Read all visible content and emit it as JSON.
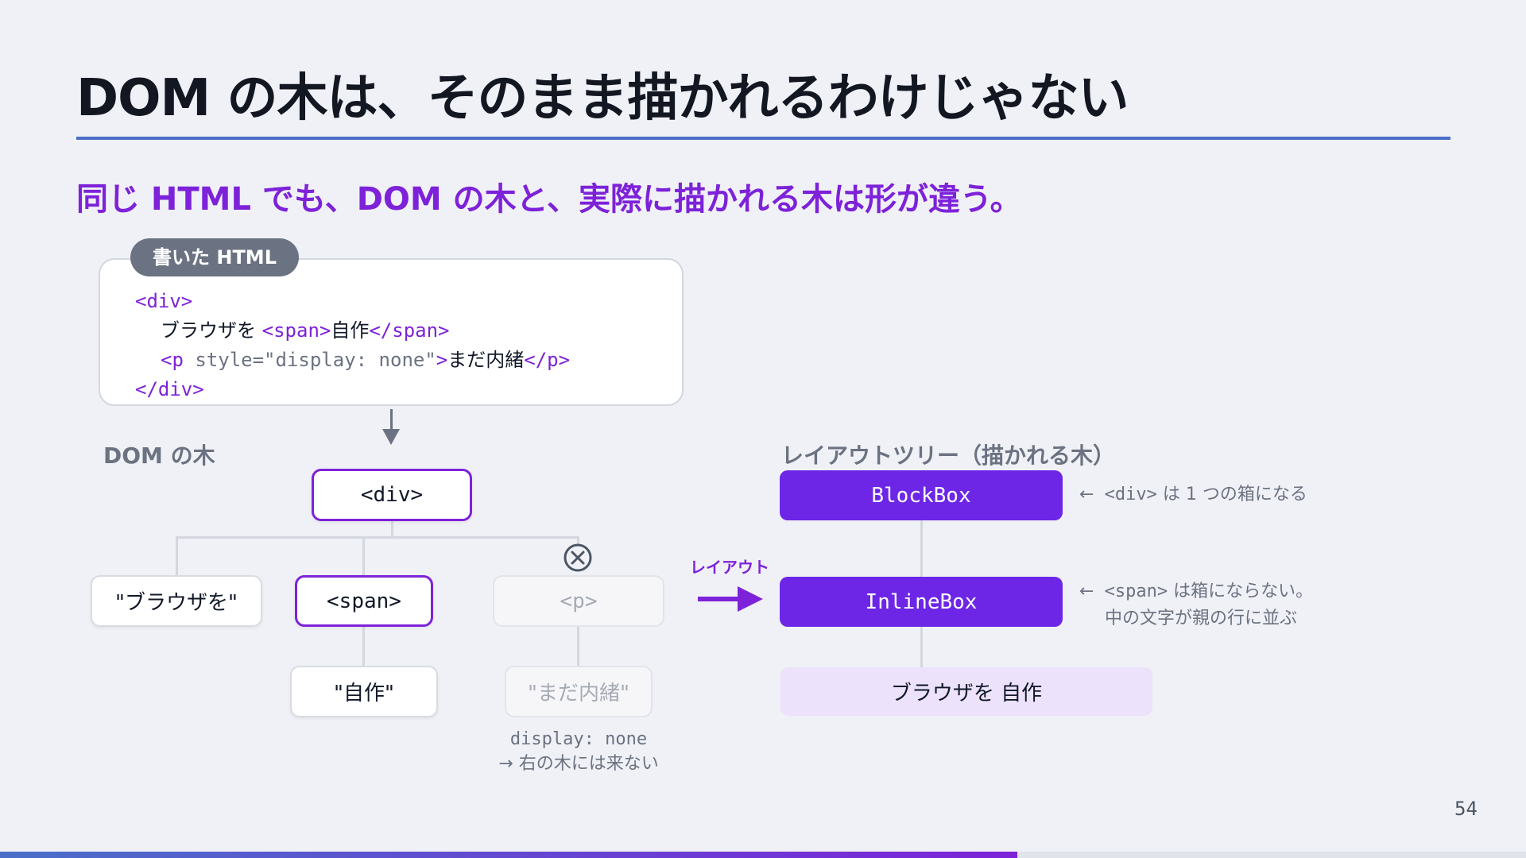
{
  "title": "DOM の木は、そのまま描かれるわけじゃない",
  "subtitle": "同じ HTML でも、DOM の木と、実際に描かれる木は形が違う。",
  "code_card": {
    "label": "書いた HTML",
    "line1_open": "<div>",
    "line2_text": "ブラウザを ",
    "line2_tag_open": "<span>",
    "line2_inner": "自作",
    "line2_tag_close": "</span>",
    "line3_tag_open": "<p",
    "line3_attr": " style=\"display: none\"",
    "line3_tag_gt": ">",
    "line3_inner": "まだ内緒",
    "line3_tag_close": "</p>",
    "line4_close": "</div>"
  },
  "dom_tree": {
    "label": "DOM の木",
    "root": "<div>",
    "children": [
      "\"ブラウザを\"",
      "<span>",
      "<p>"
    ],
    "span_child": "\"自作\"",
    "p_child": "\"まだ内緒\"",
    "removed_icon": "circle-x-icon",
    "caption_line1": "display: none",
    "caption_line2_arrow": "→",
    "caption_line2_text": " 右の木には来ない"
  },
  "transform_label": "レイアウト",
  "layout_tree": {
    "label": "レイアウトツリー（描かれる木）",
    "block_box": "BlockBox",
    "inline_box": "InlineBox",
    "text_run": "ブラウザを 自作",
    "note1_arrow": "←",
    "note1_code": " <div>",
    "note1_text": " は 1 つの箱になる",
    "note2_arrow": "←",
    "note2_code": " <span>",
    "note2_text": " は箱にならない。",
    "note2_line2": "中の文字が親の行に並ぶ"
  },
  "page_number": "54",
  "colors": {
    "accent_purple": "#7d22d9",
    "box_purple": "#6d26e6",
    "rule_blue": "#4a6fc9",
    "text_box_bg": "#ece2fc"
  }
}
